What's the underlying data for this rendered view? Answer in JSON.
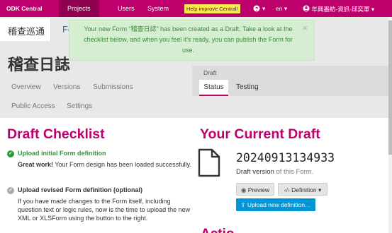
{
  "topbar": {
    "brand": "ODK Central",
    "nav": [
      "Projects",
      "Users",
      "System"
    ],
    "help": "Help improve Central!",
    "question_icon": "question-circle-icon",
    "lang": "en",
    "user": "年興墨紡-資訊-邱奕軍"
  },
  "project_tab": "稽查巡通",
  "form_link": "Fo",
  "form_title": "稽查日誌",
  "subnav": [
    "Overview",
    "Versions",
    "Submissions",
    "Public Access",
    "Settings"
  ],
  "draft_panel": {
    "label": "Draft",
    "tabs": [
      "Status",
      "Testing"
    ]
  },
  "toast": {
    "message": "Your new Form “稽查日誌” has been created as a Draft. Take a look at the checklist below, and when you feel it's ready, you can publish the Form for use.",
    "close": "×"
  },
  "checklist": {
    "title": "Draft Checklist",
    "items": [
      {
        "title": "Upload initial Form definition",
        "body_bold": "Great work!",
        "body": " Your Form design has been loaded successfully.",
        "done": true
      },
      {
        "title": "Upload revised Form definition (optional)",
        "body": "If you have made changes to the Form itself, including question text or logic rules, now is the time to upload the new XML or XLSForm using the button to the right.",
        "done": false
      }
    ]
  },
  "current_draft": {
    "title": "Your Current Draft",
    "version": "20240913134933",
    "note_prefix": "Draft version",
    "note_suffix": " of this Form.",
    "preview": "Preview",
    "definition": "Definition",
    "upload": "Upload new definition…"
  },
  "actions_heading": "Actio",
  "colors": {
    "accent": "#bd006b",
    "success": "#2e9a37",
    "info": "#0096d6"
  }
}
